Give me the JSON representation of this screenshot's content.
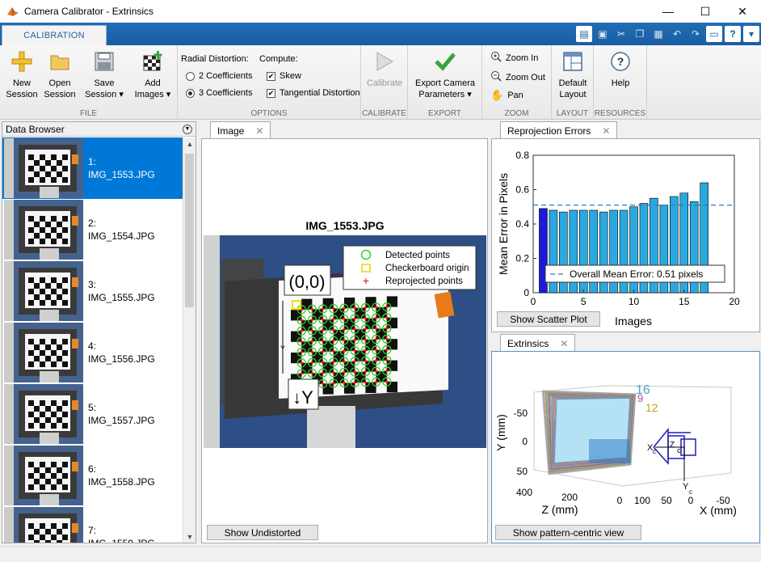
{
  "window": {
    "title": "Camera Calibrator - Extrinsics",
    "minimize": "—",
    "maximize": "☐",
    "close": "✕"
  },
  "ribbon_tab": "CALIBRATION",
  "toolstrip": {
    "file": {
      "label": "FILE",
      "new_session": [
        "New",
        "Session"
      ],
      "open_session": [
        "Open",
        "Session"
      ],
      "save_session": [
        "Save",
        "Session ▾"
      ],
      "add_images": [
        "Add",
        "Images ▾"
      ]
    },
    "options": {
      "label": "OPTIONS",
      "radial_distortion": "Radial Distortion:",
      "two_coeff": "2 Coefficients",
      "three_coeff": "3 Coefficients",
      "compute": "Compute:",
      "skew": "Skew",
      "tangential": "Tangential Distortion"
    },
    "calibrate": {
      "label": "CALIBRATE",
      "button": "Calibrate"
    },
    "export": {
      "label": "EXPORT",
      "button": [
        "Export Camera",
        "Parameters ▾"
      ]
    },
    "zoom": {
      "label": "ZOOM",
      "zoom_in": "Zoom In",
      "zoom_out": "Zoom Out",
      "pan": "Pan"
    },
    "layout": {
      "label": "LAYOUT",
      "button": [
        "Default",
        "Layout"
      ]
    },
    "resources": {
      "label": "RESOURCES",
      "button": "Help"
    }
  },
  "data_browser": {
    "title": "Data Browser",
    "items": [
      {
        "index": "1:",
        "name": "IMG_1553.JPG"
      },
      {
        "index": "2:",
        "name": "IMG_1554.JPG"
      },
      {
        "index": "3:",
        "name": "IMG_1555.JPG"
      },
      {
        "index": "4:",
        "name": "IMG_1556.JPG"
      },
      {
        "index": "5:",
        "name": "IMG_1557.JPG"
      },
      {
        "index": "6:",
        "name": "IMG_1558.JPG"
      },
      {
        "index": "7:",
        "name": "IMG_1559.JPG"
      }
    ]
  },
  "image_panel": {
    "tab": "Image",
    "image_title": "IMG_1553.JPG",
    "origin_label": "(0,0)",
    "y_label": "↓Y",
    "y_tick": "Y",
    "legend": [
      "Detected points",
      "Checkerboard origin",
      "Reprojected points"
    ],
    "button": "Show Undistorted"
  },
  "reprojection_panel": {
    "tab": "Reprojection Errors",
    "button": "Show Scatter Plot"
  },
  "extrinsics_panel": {
    "tab": "Extrinsics",
    "button": "Show pattern-centric view",
    "y_axis_label": "Y (mm)",
    "z_axis_label": "Z (mm)",
    "x_axis_label": "X (mm)",
    "y_ticks": [
      "-50",
      "0",
      "50"
    ],
    "z_ticks": [
      "400",
      "200",
      "0"
    ],
    "x_ticks": [
      "100",
      "50",
      "0",
      "-50"
    ],
    "camera_labels": [
      "X",
      "Z",
      "c",
      "c",
      "Y",
      "c"
    ],
    "pattern_labels": [
      "16",
      "9",
      "12"
    ],
    "pattern_colors": [
      "#4aa3c8",
      "#c040a0",
      "#c8a020"
    ]
  },
  "chart_data": {
    "type": "bar",
    "title": "",
    "xlabel": "Images",
    "ylabel": "Mean Error in Pixels",
    "x": [
      1,
      2,
      3,
      4,
      5,
      6,
      7,
      8,
      9,
      10,
      11,
      12,
      13,
      14,
      15,
      16
    ],
    "values": [
      0.49,
      0.48,
      0.47,
      0.48,
      0.48,
      0.48,
      0.47,
      0.48,
      0.48,
      0.5,
      0.52,
      0.55,
      0.51,
      0.56,
      0.58,
      0.53,
      0.64
    ],
    "xlim": [
      0,
      20
    ],
    "ylim": [
      0,
      0.8
    ],
    "xticks": [
      "0",
      "5",
      "10",
      "15",
      "20"
    ],
    "yticks": [
      "0",
      "0.2",
      "0.4",
      "0.6",
      "0.8"
    ],
    "mean_line": 0.51,
    "legend": "Overall Mean Error: 0.51 pixels",
    "selected_color": "#1a1adb",
    "bar_color": "#2aa9e0"
  }
}
